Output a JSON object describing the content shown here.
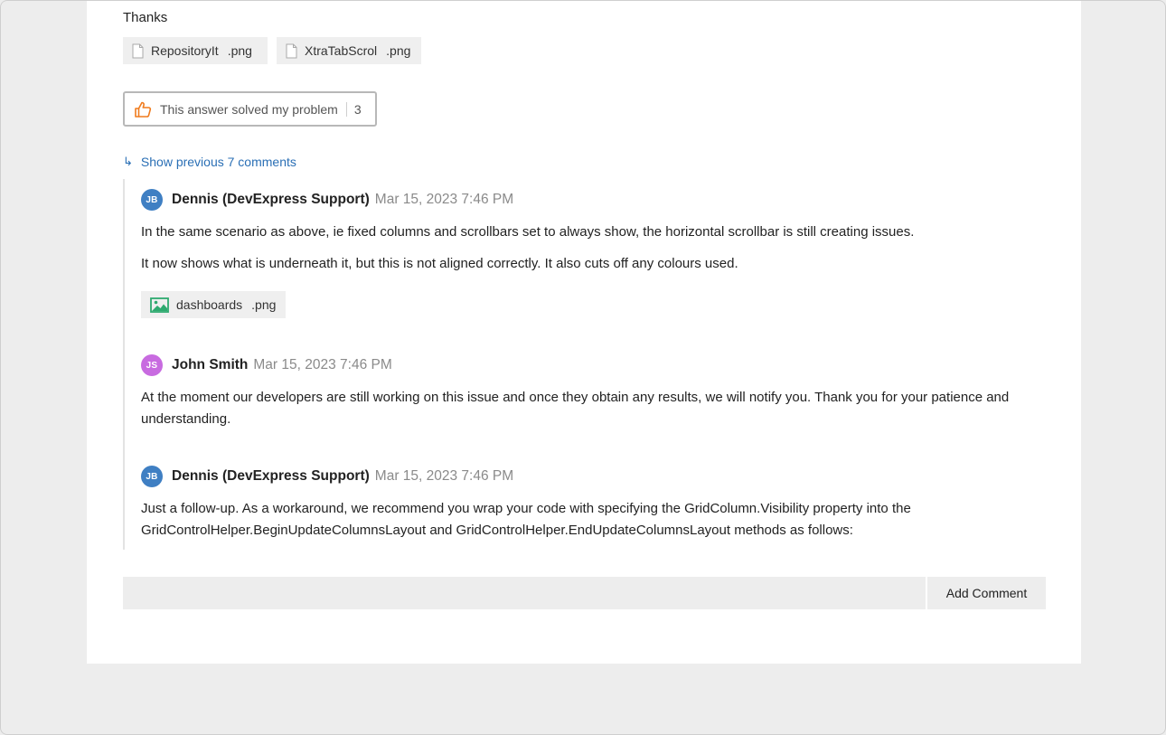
{
  "thanks_text": "Thanks",
  "attachments": [
    {
      "name": "RepositoryIt",
      "ext": ".png"
    },
    {
      "name": "XtraTabScrol",
      "ext": ".png"
    }
  ],
  "solved": {
    "label": "This answer solved my problem",
    "count": "3"
  },
  "show_previous": "Show previous 7 comments",
  "comments": [
    {
      "initials": "JB",
      "avatar_color": "#3f7fc3",
      "author": "Dennis (DevExpress Support)",
      "date": "Mar 15, 2023 7:46 PM",
      "paragraphs": [
        "In the same scenario as above, ie fixed columns and scrollbars set to always show, the horizontal scrollbar is still creating issues.",
        "It now shows what is underneath it, but this is not aligned correctly. It also cuts off any colours used."
      ],
      "attachment": {
        "name": "dashboards",
        "ext": ".png"
      }
    },
    {
      "initials": "JS",
      "avatar_color": "#c86be0",
      "author": "John Smith",
      "date": "Mar 15, 2023 7:46 PM",
      "paragraphs": [
        "At the moment our developers are still working on this issue and once they obtain any results, we will notify you. Thank you for your patience and understanding."
      ]
    },
    {
      "initials": "JB",
      "avatar_color": "#3f7fc3",
      "author": "Dennis (DevExpress Support)",
      "date": "Mar 15, 2023 7:46 PM",
      "paragraphs": [
        "Just a follow-up. As a workaround, we recommend you wrap your code with specifying the GridColumn.Visibility property into the GridControlHelper.BeginUpdateColumnsLayout and GridControlHelper.EndUpdateColumnsLayout methods as follows:"
      ]
    }
  ],
  "comment_input": {
    "placeholder": ""
  },
  "add_comment_label": "Add Comment",
  "colors": {
    "accent": "#2a6fb5",
    "thumb": "#f07b1d",
    "image_icon": "#2eaa6f"
  }
}
